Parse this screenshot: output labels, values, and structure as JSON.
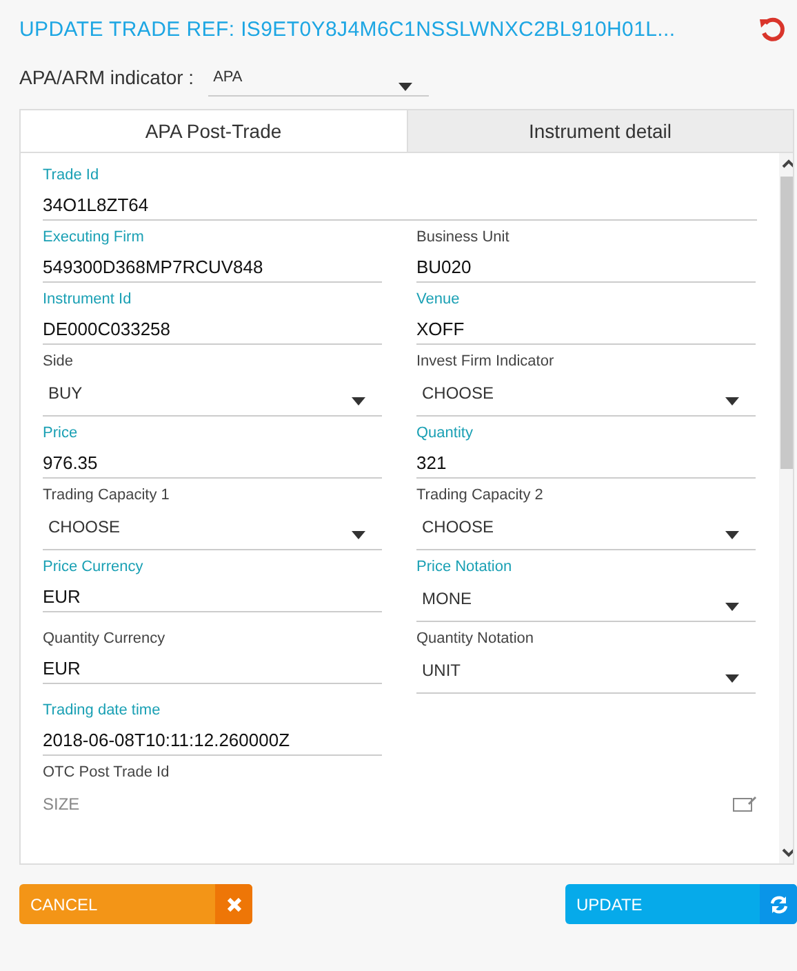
{
  "title": "UPDATE TRADE REF: IS9ET0Y8J4M6C1NSSLWNXC2BL910H01L...",
  "indicator": {
    "label": "APA/ARM indicator :",
    "value": "APA"
  },
  "tabs": [
    {
      "label": "APA Post-Trade",
      "selected": true
    },
    {
      "label": "Instrument detail",
      "selected": false
    }
  ],
  "rows": [
    [
      {
        "label": "Trade Id",
        "required": true,
        "kind": "input",
        "value": "34O1L8ZT64"
      }
    ],
    [
      {
        "label": "Executing Firm",
        "required": true,
        "kind": "input",
        "value": "549300D368MP7RCUV848"
      },
      {
        "label": "Business Unit",
        "required": false,
        "kind": "input",
        "value": "BU020"
      }
    ],
    [
      {
        "label": "Instrument Id",
        "required": true,
        "kind": "input",
        "value": "DE000C033258"
      },
      {
        "label": "Venue",
        "required": true,
        "kind": "input",
        "value": "XOFF"
      }
    ],
    [
      {
        "label": "Side",
        "required": false,
        "kind": "select",
        "value": "BUY"
      },
      {
        "label": "Invest Firm Indicator",
        "required": false,
        "kind": "select",
        "value": "CHOOSE"
      }
    ],
    [
      {
        "label": "Price",
        "required": true,
        "kind": "input",
        "value": "976.35"
      },
      {
        "label": "Quantity",
        "required": true,
        "kind": "input",
        "value": "321"
      }
    ],
    [
      {
        "label": "Trading Capacity 1",
        "required": false,
        "kind": "select",
        "value": "CHOOSE"
      },
      {
        "label": "Trading Capacity 2",
        "required": false,
        "kind": "select",
        "value": "CHOOSE"
      }
    ],
    [
      {
        "label": "Price Currency",
        "required": true,
        "kind": "input",
        "value": "EUR"
      },
      {
        "label": "Price Notation",
        "required": true,
        "kind": "select",
        "value": "MONE"
      }
    ],
    [
      {
        "label": "Quantity Currency",
        "required": false,
        "kind": "input",
        "value": "EUR"
      },
      {
        "label": "Quantity Notation",
        "required": false,
        "kind": "select",
        "value": "UNIT"
      }
    ],
    [
      {
        "label": "Trading date time",
        "required": true,
        "kind": "input",
        "value": "2018-06-08T10:11:12.260000Z"
      }
    ],
    [
      {
        "label": "OTC Post Trade Id",
        "required": false,
        "kind": "placeholder",
        "placeholder": "SIZE"
      }
    ]
  ],
  "buttons": [
    {
      "label": "CANCEL",
      "kind": "cancel"
    },
    {
      "label": "UPDATE",
      "kind": "update"
    }
  ]
}
